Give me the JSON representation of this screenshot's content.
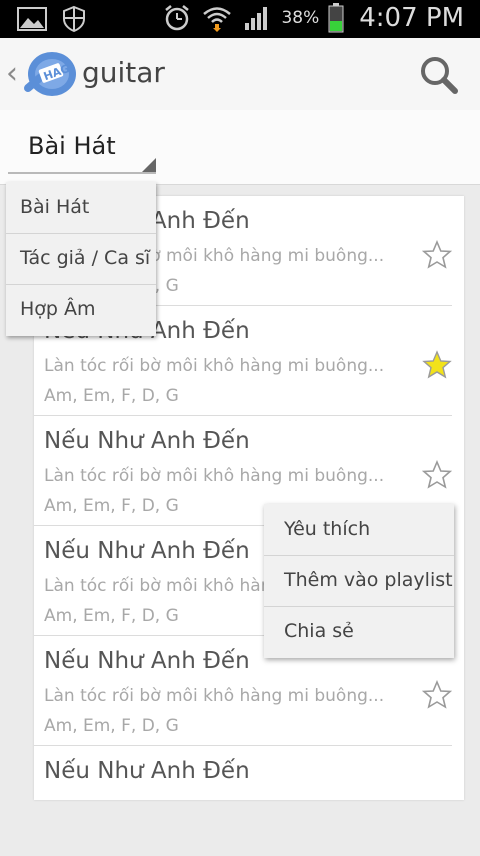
{
  "status_bar": {
    "battery_percent": "38%",
    "time": "4:07 PM",
    "icons": [
      "gallery-icon",
      "shield-icon",
      "alarm-icon",
      "wifi-icon",
      "signal-icon",
      "battery-icon"
    ]
  },
  "action_bar": {
    "title": "guitar",
    "logo_text": "HAG",
    "icons": [
      "back-chevron-icon",
      "app-logo-icon",
      "search-icon"
    ]
  },
  "filter": {
    "selected": "Bài Hát"
  },
  "dropdown": {
    "options": [
      "Bài Hát",
      "Tác giả / Ca sĩ",
      "Hợp Âm"
    ]
  },
  "songs": [
    {
      "title": "Nếu Như Anh Đến",
      "lyric": "Làn tóc rối bờ môi khô hàng mi buông...",
      "chords": "Am, Em, F, D, G",
      "favorite": false
    },
    {
      "title": "Nếu Như Anh Đến",
      "lyric": "Làn tóc rối bờ môi khô hàng mi buông...",
      "chords": "Am, Em, F, D, G",
      "favorite": true
    },
    {
      "title": "Nếu Như Anh Đến",
      "lyric": "Làn tóc rối bờ môi khô hàng mi buông...",
      "chords": "Am, Em, F, D, G",
      "favorite": false
    },
    {
      "title": "Nếu Như Anh Đến",
      "lyric": "Làn tóc rối bờ môi khô hàng mi buông...",
      "chords": "Am, Em, F, D, G",
      "favorite": false
    },
    {
      "title": "Nếu Như Anh Đến",
      "lyric": "Làn tóc rối bờ môi khô hàng mi buông...",
      "chords": "Am, Em, F, D, G",
      "favorite": false
    },
    {
      "title": "Nếu Như Anh Đến",
      "lyric": "",
      "chords": "",
      "favorite": false
    }
  ],
  "context_menu": {
    "items": [
      "Yêu thích",
      "Thêm vào playlist",
      "Chia sẻ"
    ]
  },
  "colors": {
    "star_active": "#f2e21a",
    "star_inactive": "#9a9a9a",
    "logo_blue": "#5b8fd8",
    "battery_green": "#38d13a"
  }
}
